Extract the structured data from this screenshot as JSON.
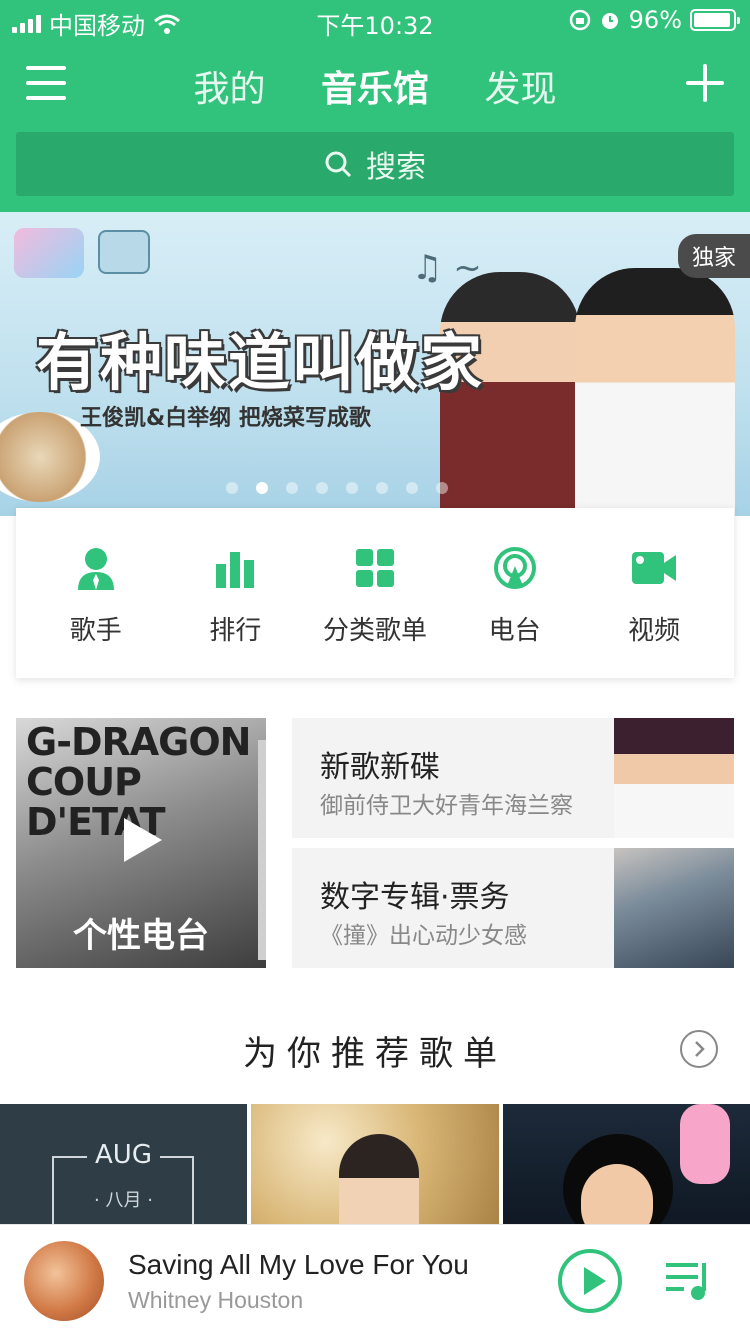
{
  "status_bar": {
    "carrier": "中国移动",
    "time": "下午10:32",
    "battery": "96%",
    "battery_level": 0.96
  },
  "header": {
    "tabs": [
      {
        "label": "我的",
        "active": false
      },
      {
        "label": "音乐馆",
        "active": true
      },
      {
        "label": "发现",
        "active": false
      }
    ],
    "search_placeholder": "搜索"
  },
  "banner": {
    "badge": "独家",
    "title": "有种味道叫做家",
    "subtitle": "王俊凯&白举纲 把烧菜写成歌",
    "page_count": 8,
    "active_page": 2
  },
  "shortcuts": [
    {
      "label": "歌手",
      "icon": "singer-icon"
    },
    {
      "label": "排行",
      "icon": "ranking-icon"
    },
    {
      "label": "分类歌单",
      "icon": "category-icon"
    },
    {
      "label": "电台",
      "icon": "radio-icon"
    },
    {
      "label": "视频",
      "icon": "video-icon"
    }
  ],
  "features": {
    "radio": {
      "cover_text_line1": "G-DRAGON",
      "cover_text_line2": "COUP D'ETAT",
      "label": "个性电台"
    },
    "tiles": [
      {
        "title": "新歌新碟",
        "subtitle": "御前侍卫大好青年海兰察"
      },
      {
        "title": "数字专辑·票务",
        "subtitle": "《撞》出心动少女感"
      }
    ]
  },
  "recommend": {
    "title": "为你推荐歌单",
    "playlists": [
      {
        "cover_text": "AUG",
        "cover_subtext": "· 八月 ·"
      },
      {
        "cover_text": ""
      },
      {
        "cover_text": ""
      }
    ]
  },
  "player": {
    "song": "Saving All My Love For You",
    "artist": "Whitney Houston"
  },
  "colors": {
    "brand": "#31c27c",
    "search_bg": "#2aa96c",
    "tile_bg": "#f3f3f3"
  }
}
